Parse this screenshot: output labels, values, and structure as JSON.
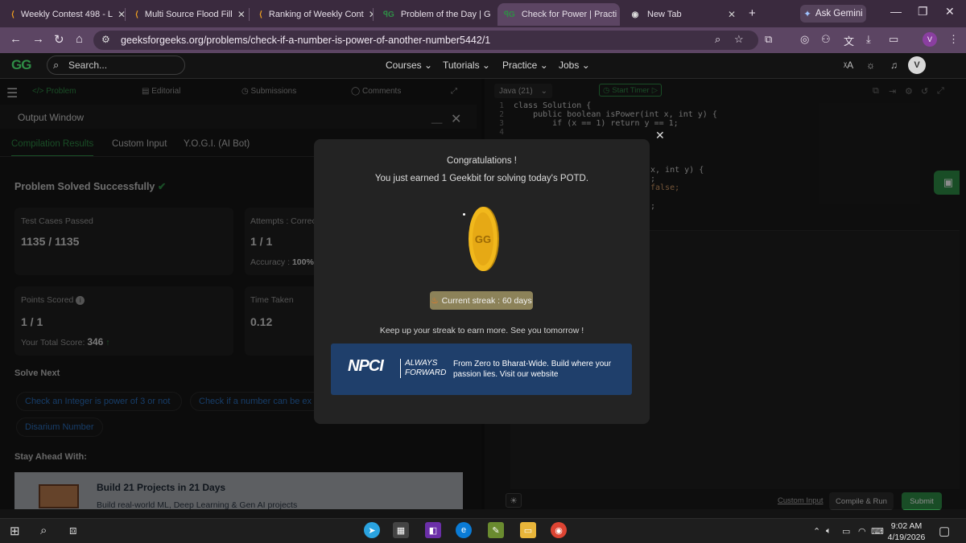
{
  "browser": {
    "tabs": [
      {
        "label": "Weekly Contest 498 - L",
        "icon": "leetcode-icon"
      },
      {
        "label": "Multi Source Flood Fill",
        "icon": "leetcode-icon"
      },
      {
        "label": "Ranking of Weekly Cont",
        "icon": "leetcode-icon"
      },
      {
        "label": "Problem of the Day | G",
        "icon": "gfg-icon"
      },
      {
        "label": "Check for Power | Practi",
        "icon": "gfg-icon"
      },
      {
        "label": "New Tab",
        "icon": "chrome-icon"
      }
    ],
    "new_tab": "+",
    "gemini_label": "Ask Gemini",
    "url": "geeksforgeeks.org/problems/check-if-a-number-is-power-of-another-number5442/1",
    "profile_initial": "V"
  },
  "site": {
    "logo": "GG",
    "search_placeholder": "Search...",
    "nav": [
      "Courses",
      "Tutorials",
      "Practice",
      "Jobs"
    ],
    "user_initial": "V"
  },
  "problem_tabs": [
    "Problem",
    "Editorial",
    "Submissions",
    "Comments"
  ],
  "output_window": {
    "title": "Output Window",
    "tabs": [
      "Compilation Results",
      "Custom Input",
      "Y.O.G.I. (AI Bot)"
    ],
    "status": "Problem Solved Successfully",
    "cards": {
      "test_cases_label": "Test Cases Passed",
      "test_cases_value": "1135 / 1135",
      "attempts_label": "Attempts : Correc",
      "attempts_value": "1 / 1",
      "accuracy_label": "Accuracy :",
      "accuracy_value": "100%",
      "points_label": "Points Scored",
      "points_value": "1 / 1",
      "total_score_label": "Your Total Score:",
      "total_score_value": "346",
      "time_label": "Time Taken",
      "time_value": "0.12"
    },
    "solve_next_heading": "Solve Next",
    "solve_next": [
      "Check an Integer is power of 3 or not",
      "Check if a number can be ex",
      "Disarium Number"
    ],
    "stay_ahead_heading": "Stay Ahead With:",
    "promo_title": "Build 21 Projects in 21 Days",
    "promo_subtitle": "Build real-world ML, Deep Learning & Gen AI projects"
  },
  "editor": {
    "language": "Java (21)",
    "timer": "Start Timer",
    "line_numbers": [
      "1",
      "2",
      "3",
      "4"
    ],
    "code_lines": [
      "class Solution {",
      "    public boolean isPower(int x, int y) {",
      "        if (x == 1) return y == 1;",
      ""
    ],
    "code_fragments": [
      "x, int y) {",
      ";",
      "false;",
      ";"
    ],
    "custom_input": "Custom Input",
    "compile_run": "Compile & Run",
    "submit": "Submit"
  },
  "modal": {
    "title": "Congratulations !",
    "message": "You just earned 1 Geekbit for solving today's POTD.",
    "coin_logo": "GG",
    "streak": "Current streak : 60 days",
    "keep_up": "Keep up your streak to earn more. See you tomorrow !",
    "ad": {
      "brand": "NPCI",
      "tagline_1": "ALWAYS",
      "tagline_2": "FORWARD",
      "text": "From Zero to Bharat-Wide. Build where your passion lies. Visit our website"
    }
  },
  "taskbar": {
    "time": "9:02 AM",
    "date": "4/19/2026"
  },
  "colors": {
    "gfg_green": "#2f8d46",
    "chrome_tab": "#5c4563",
    "streak_badge": "#8c8259",
    "ad_background": "#1f3f6b"
  }
}
